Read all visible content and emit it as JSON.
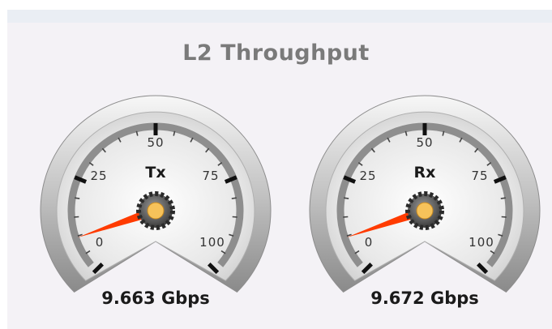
{
  "title": "L2 Throughput",
  "colors": {
    "needle": "#ff3b00",
    "hub_center": "#f6c25a",
    "tick_major": "#111111",
    "tick_minor": "#444444"
  },
  "scale": {
    "min": 0,
    "max": 100,
    "labels": [
      "0",
      "25",
      "50",
      "75",
      "100"
    ]
  },
  "gauges": [
    {
      "label": "Tx",
      "value": 9.663,
      "readout": "9.663 Gbps"
    },
    {
      "label": "Rx",
      "value": 9.672,
      "readout": "9.672 Gbps"
    }
  ]
}
